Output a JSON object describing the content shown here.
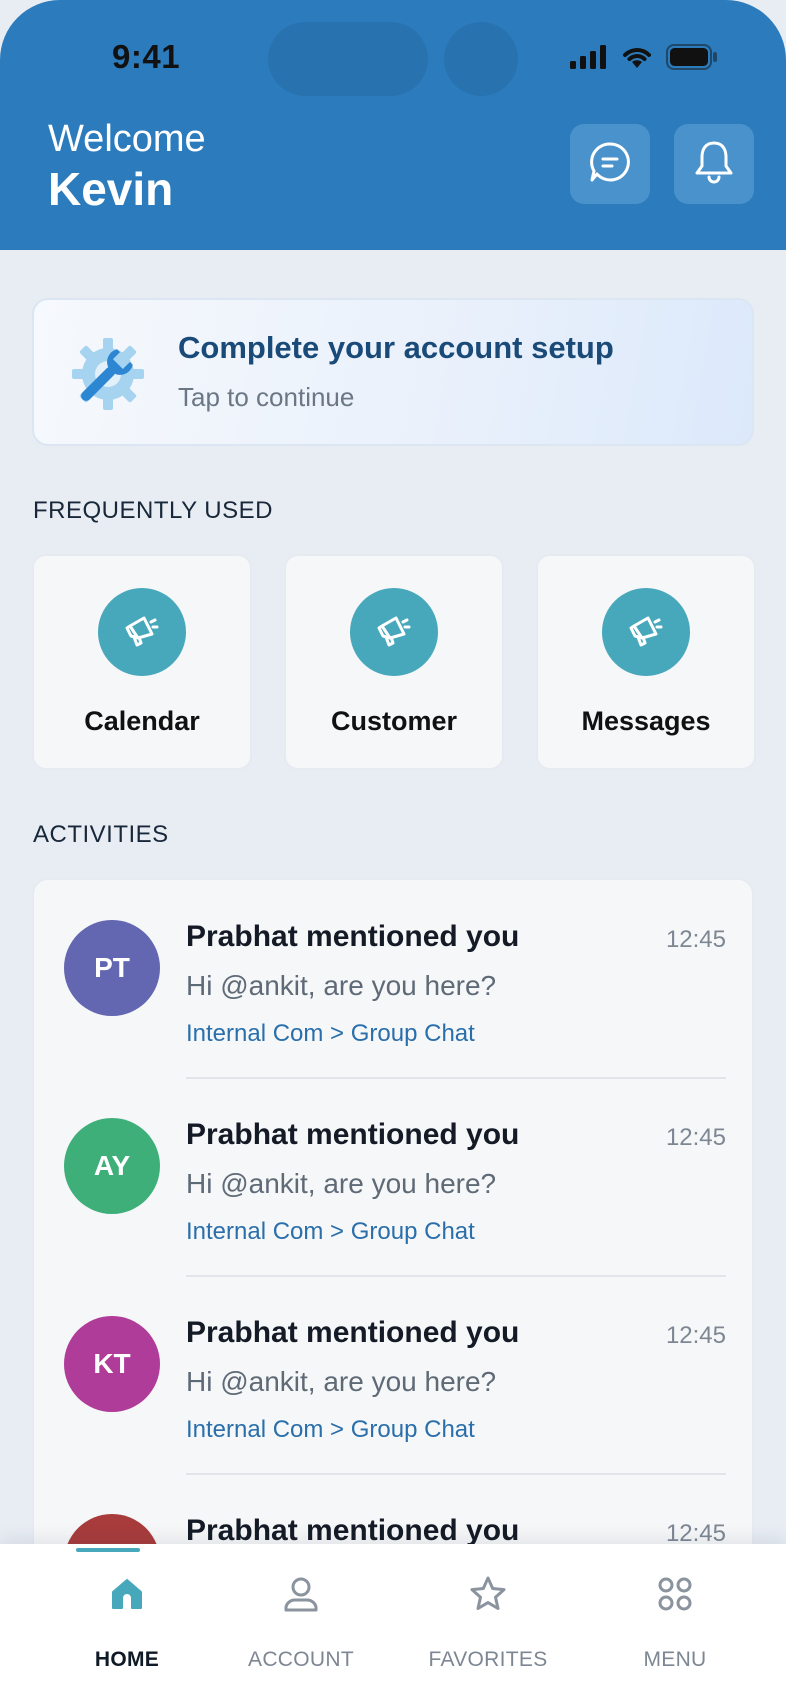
{
  "status_bar": {
    "time": "9:41"
  },
  "header": {
    "welcome": "Welcome",
    "user_name": "Kevin",
    "accent": "#2c7cbd"
  },
  "setup_card": {
    "title": "Complete your account setup",
    "subtitle": "Tap to continue",
    "icon": "gear-wrench-icon"
  },
  "frequently_used": {
    "label": "FREQUENTLY USED",
    "items": [
      {
        "label": "Calendar",
        "icon": "megaphone-icon"
      },
      {
        "label": "Customer",
        "icon": "megaphone-icon"
      },
      {
        "label": "Messages",
        "icon": "megaphone-icon"
      }
    ]
  },
  "activities": {
    "label": "ACTIVITIES",
    "items": [
      {
        "initials": "PT",
        "color": "#6366b1",
        "title": "Prabhat mentioned you",
        "time": "12:45",
        "message": "Hi @ankit, are you here?",
        "path": "Internal Com > Group Chat"
      },
      {
        "initials": "AY",
        "color": "#3faf7a",
        "title": "Prabhat mentioned you",
        "time": "12:45",
        "message": "Hi @ankit, are you here?",
        "path": "Internal Com > Group Chat"
      },
      {
        "initials": "KT",
        "color": "#b03c9a",
        "title": "Prabhat mentioned you",
        "time": "12:45",
        "message": "Hi @ankit, are you here?",
        "path": "Internal Com > Group Chat"
      },
      {
        "initials": "",
        "color": "#a83c3c",
        "title": "Prabhat mentioned you",
        "time": "12:45",
        "message": "",
        "path": ""
      }
    ]
  },
  "tabbar": {
    "active": "HOME",
    "tabs": [
      {
        "label": "HOME",
        "icon": "home-icon"
      },
      {
        "label": "ACCOUNT",
        "icon": "user-icon"
      },
      {
        "label": "FAVORITES",
        "icon": "star-icon"
      },
      {
        "label": "MENU",
        "icon": "grid-icon"
      }
    ]
  }
}
